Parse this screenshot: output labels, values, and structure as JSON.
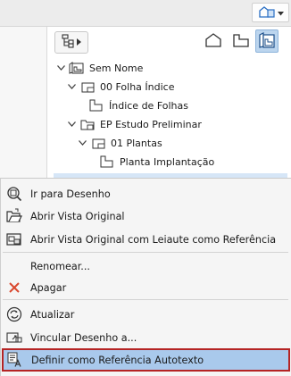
{
  "topbar": {
    "button_icon": "navigator-layout-icon",
    "dropdown_icon": "caret-down-icon"
  },
  "tree_toolbar": {
    "nav_icon": "navigator-tree-icon",
    "nav_arrow_icon": "caret-right-icon",
    "views": [
      "project-map-icon",
      "view-map-icon",
      "layout-book-icon"
    ],
    "active_view": "layout-book-icon"
  },
  "tree": {
    "items": [
      {
        "label": "Sem Nome",
        "expanded": true,
        "icon": "layout-book-icon"
      },
      {
        "label": "00 Folha Índice",
        "expanded": true,
        "icon": "master-layout-icon"
      },
      {
        "label": "Índice de Folhas",
        "expanded": false,
        "icon": "layout-icon"
      },
      {
        "label": "EP Estudo Preliminar",
        "expanded": true,
        "icon": "subset-folder-icon"
      },
      {
        "label": "01 Plantas",
        "expanded": true,
        "icon": "master-layout-icon"
      },
      {
        "label": "Planta Implantação",
        "expanded": false,
        "icon": "layout-icon"
      }
    ]
  },
  "menu": {
    "items": [
      {
        "label": "Ir para Desenho",
        "icon": "go-to-drawing-icon"
      },
      {
        "label": "Abrir Vista Original",
        "icon": "open-folder-icon"
      },
      {
        "label": "Abrir Vista Original com Leiaute como Referência",
        "icon": "open-reference-icon"
      },
      {
        "label": "Renomear...",
        "icon": ""
      },
      {
        "label": "Apagar",
        "icon": "delete-x-icon"
      },
      {
        "label": "Atualizar",
        "icon": "refresh-icon"
      },
      {
        "label": "Vincular Desenho a...",
        "icon": "link-drawing-icon"
      },
      {
        "label": "Definir como Referência Autotexto",
        "icon": "autotext-reference-icon",
        "selected": true
      }
    ]
  },
  "colors": {
    "selection_fill": "#a9c9ec",
    "selection_border": "#b52424",
    "delete_icon": "#d9482e",
    "active_view": "#bcd5ee"
  }
}
